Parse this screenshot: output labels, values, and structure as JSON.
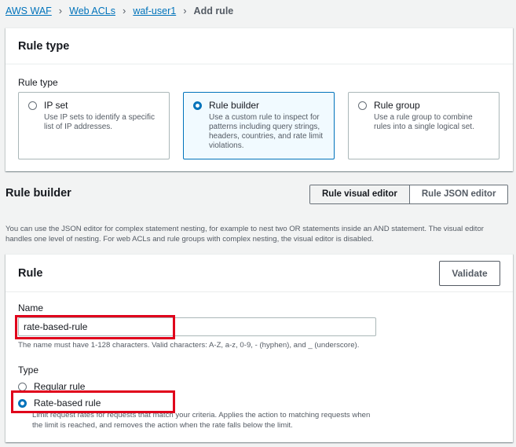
{
  "breadcrumb": {
    "items": [
      "AWS WAF",
      "Web ACLs",
      "waf-user1"
    ],
    "current": "Add rule"
  },
  "rule_type_panel": {
    "title": "Rule type",
    "field_label": "Rule type",
    "options": [
      {
        "label": "IP set",
        "desc": "Use IP sets to identify a specific list of IP addresses.",
        "selected": false
      },
      {
        "label": "Rule builder",
        "desc": "Use a custom rule to inspect for patterns including query strings, headers, countries, and rate limit violations.",
        "selected": true
      },
      {
        "label": "Rule group",
        "desc": "Use a rule group to combine rules into a single logical set.",
        "selected": false
      }
    ]
  },
  "rule_builder": {
    "title": "Rule builder",
    "editor_tabs": [
      "Rule visual editor",
      "Rule JSON editor"
    ],
    "active_tab": "Rule visual editor",
    "note": "You can use the JSON editor for complex statement nesting, for example to nest two OR statements inside an AND statement. The visual editor handles one level of nesting. For web ACLs and rule groups with complex nesting, the visual editor is disabled."
  },
  "rule_panel": {
    "title": "Rule",
    "validate_label": "Validate",
    "name_label": "Name",
    "name_value": "rate-based-rule",
    "name_hint": "The name must have 1-128 characters. Valid characters: A-Z, a-z, 0-9, - (hyphen), and _ (underscore).",
    "type_label": "Type",
    "type_options": [
      {
        "label": "Regular rule",
        "selected": false,
        "desc": ""
      },
      {
        "label": "Rate-based rule",
        "selected": true,
        "desc": "Limit request rates for requests that match your criteria. Applies the action to matching requests when the limit is reached, and removes the action when the rate falls below the limit."
      }
    ]
  },
  "colors": {
    "accent": "#0073bb",
    "highlight": "#e0001b",
    "background": "#f2f3f3"
  }
}
